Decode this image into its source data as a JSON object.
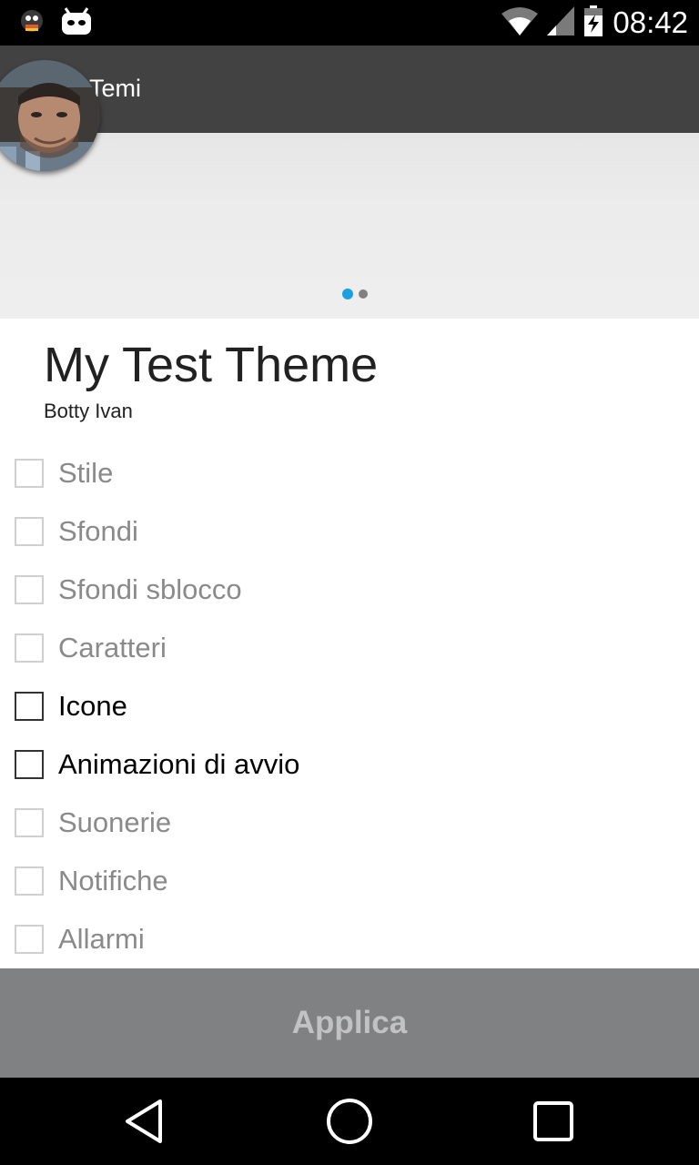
{
  "status_bar": {
    "time": "08:42"
  },
  "app_bar": {
    "title": "Temi"
  },
  "preview": {
    "page_count": 2,
    "current_page": 1
  },
  "theme": {
    "title": "My Test Theme",
    "author": "Botty Ivan"
  },
  "options": [
    {
      "label": "Stile",
      "enabled": false,
      "checked": false
    },
    {
      "label": "Sfondi",
      "enabled": false,
      "checked": false
    },
    {
      "label": "Sfondi sblocco",
      "enabled": false,
      "checked": false
    },
    {
      "label": "Caratteri",
      "enabled": false,
      "checked": false
    },
    {
      "label": "Icone",
      "enabled": true,
      "checked": false
    },
    {
      "label": "Animazioni di avvio",
      "enabled": true,
      "checked": false
    },
    {
      "label": "Suonerie",
      "enabled": false,
      "checked": false
    },
    {
      "label": "Notifiche",
      "enabled": false,
      "checked": false
    },
    {
      "label": "Allarmi",
      "enabled": false,
      "checked": false
    }
  ],
  "apply_button": {
    "label": "Applica"
  },
  "colors": {
    "accent": "#1ba1e2",
    "app_bar": "#424242",
    "apply_bg": "#808183",
    "apply_text": "#c2c2c4"
  },
  "icons": [
    "notification-app-icon",
    "android-debug-icon",
    "wifi-icon",
    "signal-icon",
    "battery-charging-icon",
    "back-icon",
    "home-icon",
    "recents-icon"
  ]
}
